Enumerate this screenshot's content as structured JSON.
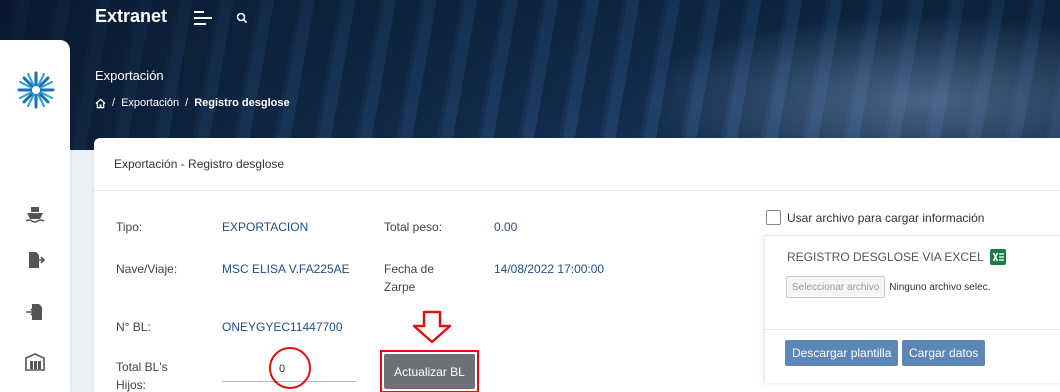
{
  "app": {
    "title": "Extranet"
  },
  "header": {
    "section_title": "Exportación",
    "breadcrumb": {
      "parent": "Exportación",
      "current": "Registro desglose"
    }
  },
  "sidebar": {
    "items": [
      {
        "icon": "ship-icon"
      },
      {
        "icon": "document-export-icon"
      },
      {
        "icon": "document-import-icon"
      },
      {
        "icon": "warehouse-icon"
      }
    ]
  },
  "card": {
    "title": "Exportación - Registro desglose",
    "fields": {
      "tipo_label": "Tipo:",
      "tipo_value": "EXPORTACION",
      "peso_label": "Total peso:",
      "peso_value": "0.00",
      "nave_label": "Nave/Viaje:",
      "nave_value": "MSC ELISA V.FA225AE",
      "zarpe_label_1": "Fecha de",
      "zarpe_label_2": "Zarpe",
      "zarpe_value": "14/08/2022 17:00:00",
      "bl_label": "N° BL:",
      "bl_value": "ONEYGYEC11447700",
      "hijos_label_1": "Total BL's",
      "hijos_label_2": "Hijos:",
      "hijos_value": "0"
    },
    "actualizar_label": "Actualizar BL"
  },
  "excel": {
    "checkbox_label": "Usar archivo para cargar información",
    "title": "REGISTRO DESGLOSE VIA EXCEL",
    "file_button": "Seleccionar archivo",
    "file_status": "Ninguno archivo selec.",
    "download_label": "Descargar plantilla",
    "upload_label": "Cargar datos"
  },
  "colors": {
    "accent_blue": "#5b86b6",
    "link_blue": "#1f4f86",
    "annotation_red": "#dd1111",
    "button_gray": "#6d7175"
  }
}
